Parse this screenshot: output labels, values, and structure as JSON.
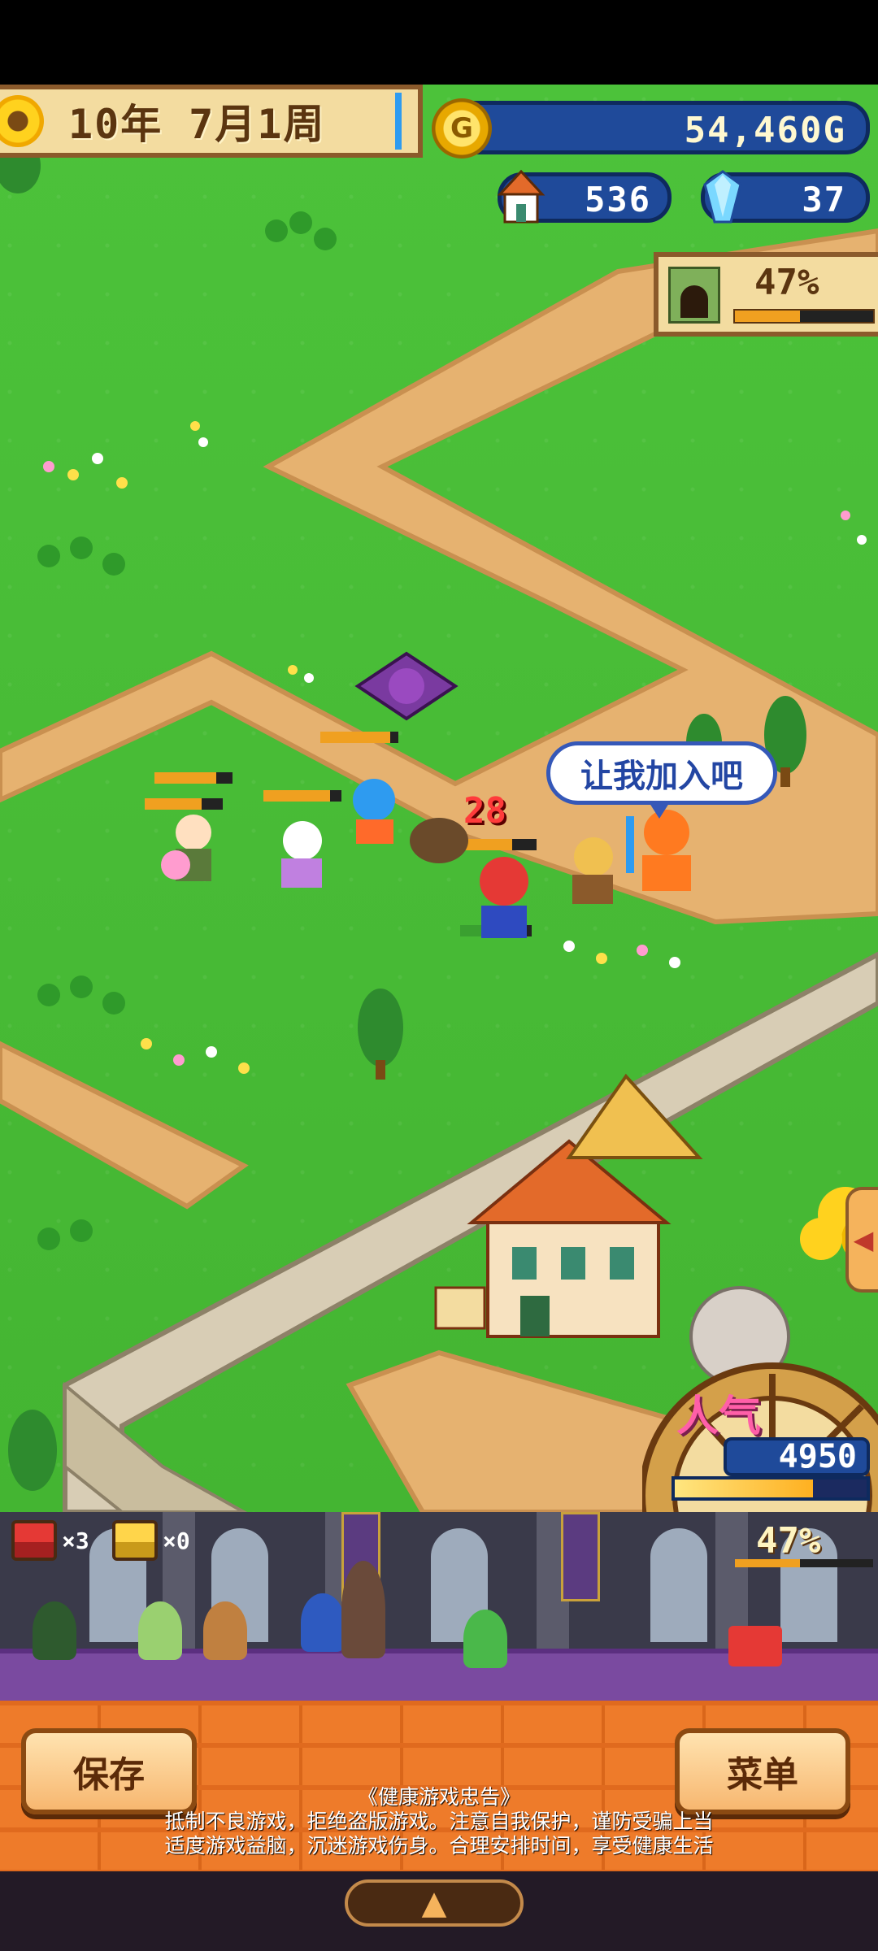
{
  "hud": {
    "date": "10年 7月1周",
    "gold": "54,460G",
    "gold_symbol": "G",
    "population": "536",
    "gems": "37",
    "dungeon_progress_label": "47%",
    "dungeon_progress": 0.47
  },
  "scene": {
    "speech_bubble": "让我加入吧",
    "damage_number": "28"
  },
  "popularity": {
    "label": "人气",
    "score": "4950",
    "meter": 0.72
  },
  "hall": {
    "red_chest_count": "×3",
    "gold_chest_count": "×0",
    "progress_label": "47%",
    "progress": 0.47
  },
  "buttons": {
    "save": "保存",
    "menu": "菜单"
  },
  "notice": {
    "title": "《健康游戏忠告》",
    "line1": "抵制不良游戏，拒绝盗版游戏。注意自我保护，谨防受骗上当",
    "line2": "适度游戏益脑，沉迷游戏伤身。合理安排时间，享受健康生活"
  },
  "colors": {
    "grass": "#44b532",
    "path": "#e6b270",
    "panel_blue": "#1f4a9a",
    "panel_beige": "#f3dca0",
    "brick": "#ee7b2a"
  }
}
